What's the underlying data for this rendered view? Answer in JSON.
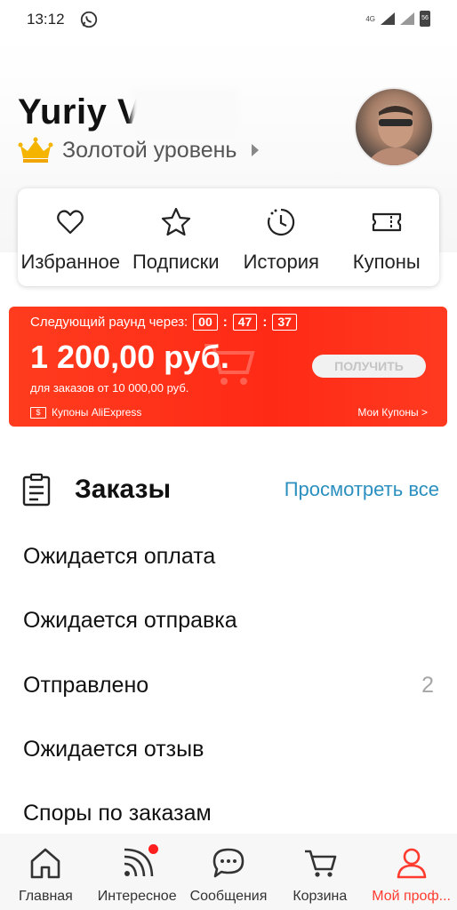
{
  "status": {
    "time": "13:12",
    "network": "4G",
    "battery": "56"
  },
  "profile": {
    "name": "Yuriy V",
    "level": "Золотой уровень"
  },
  "quick_links": [
    {
      "label": "Избранное",
      "icon": "heart-icon"
    },
    {
      "label": "Подписки",
      "icon": "star-icon"
    },
    {
      "label": "История",
      "icon": "history-clock-icon"
    },
    {
      "label": "Купоны",
      "icon": "ticket-icon"
    }
  ],
  "coupon": {
    "round_label": "Следующий раунд через:",
    "timer": {
      "hours": "00",
      "minutes": "47",
      "seconds": "37"
    },
    "amount": "1 200,00 руб.",
    "condition": "для заказов от 10 000,00 руб.",
    "get_label": "ПОЛУЧИТЬ",
    "source": "Купоны AliExpress",
    "my_coupons": "Мои Купоны >",
    "colors": {
      "background": "#ff3c1e"
    }
  },
  "orders": {
    "title": "Заказы",
    "view_all": "Просмотреть все",
    "rows": [
      {
        "label": "Ожидается оплата",
        "count": ""
      },
      {
        "label": "Ожидается отправка",
        "count": ""
      },
      {
        "label": "Отправлено",
        "count": "2"
      },
      {
        "label": "Ожидается отзыв",
        "count": ""
      },
      {
        "label": "Споры по заказам",
        "count": ""
      }
    ]
  },
  "bottom_nav": [
    {
      "label": "Главная",
      "icon": "home-icon"
    },
    {
      "label": "Интересное",
      "icon": "feed-icon"
    },
    {
      "label": "Сообщения",
      "icon": "chat-icon"
    },
    {
      "label": "Корзина",
      "icon": "cart-icon"
    },
    {
      "label": "Мой проф...",
      "icon": "profile-icon"
    }
  ],
  "accent_colors": {
    "link": "#2b8fbf",
    "active_tab": "#ff3b30"
  }
}
